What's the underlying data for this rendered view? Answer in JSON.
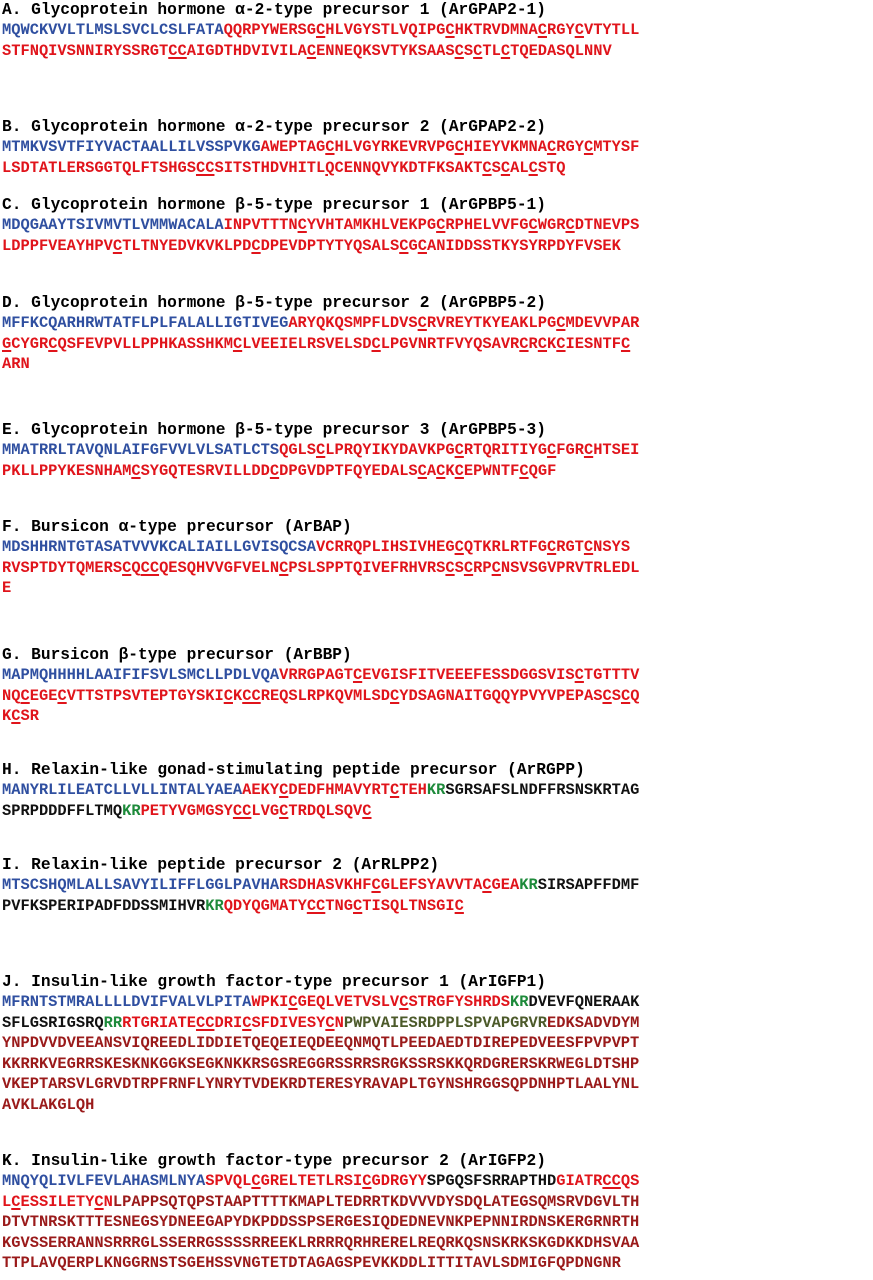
{
  "colors": {
    "sig": "#2f4fa0",
    "pep": "#e0141b",
    "oth": "#111111",
    "kr": "#1d8a3a",
    "ol": "#4c5a2a",
    "dr": "#9a1a1a"
  },
  "sections": [
    {
      "title": "A. Glycoprotein hormone α-2-type precursor 1 (ArGPAP2-1)",
      "lines": [
        [
          [
            "sig",
            "MQWCKVVLTLMSLSVCLCSLFATA"
          ],
          [
            "pep",
            "QQRPYWERSG"
          ],
          [
            "pepu",
            "C"
          ],
          [
            "pep",
            "HLVGYSTLVQIPG"
          ],
          [
            "pepu",
            "C"
          ],
          [
            "pep",
            "HKTRVDMNA"
          ],
          [
            "pepu",
            "C"
          ],
          [
            "pep",
            "RGY"
          ],
          [
            "pepu",
            "C"
          ],
          [
            "pep",
            "VTYTLL"
          ]
        ],
        [
          [
            "pep",
            "STFNQIVSNNIRYSSRGT"
          ],
          [
            "pepu",
            "CC"
          ],
          [
            "pep",
            "AIGDTHDVIVILA"
          ],
          [
            "pepu",
            "C"
          ],
          [
            "pep",
            "ENNEQKSVTYKSAAS"
          ],
          [
            "pepu",
            "C"
          ],
          [
            "pep",
            "S"
          ],
          [
            "pepu",
            "C"
          ],
          [
            "pep",
            "TL"
          ],
          [
            "pepu",
            "C"
          ],
          [
            "pep",
            "TQEDASQLNNV"
          ]
        ]
      ]
    },
    {
      "title": "B. Glycoprotein hormone α-2-type precursor 2 (ArGPAP2-2)",
      "lines": [
        [
          [
            "sig",
            "MTMKVSVTFIYVACTAALLILVSSPVKG"
          ],
          [
            "pep",
            "AWEPTAG"
          ],
          [
            "pepu",
            "C"
          ],
          [
            "pep",
            "HLVGYRKEVRVPG"
          ],
          [
            "pepu",
            "C"
          ],
          [
            "pep",
            "HIEYVKMNA"
          ],
          [
            "pepu",
            "C"
          ],
          [
            "pep",
            "RGY"
          ],
          [
            "pepu",
            "C"
          ],
          [
            "pep",
            "MTYSF"
          ]
        ],
        [
          [
            "pep",
            "LSDTATLERSGGTQLFTSHGS"
          ],
          [
            "pepu",
            "CC"
          ],
          [
            "pep",
            "SITSTHDVHITL"
          ],
          [
            "pepu",
            "Q"
          ],
          [
            "pep",
            "CENNQVYKDTFKSAKT"
          ],
          [
            "pepu",
            "C"
          ],
          [
            "pep",
            "S"
          ],
          [
            "pepu",
            "C"
          ],
          [
            "pep",
            "AL"
          ],
          [
            "pepu",
            "C"
          ],
          [
            "pep",
            "STQ"
          ]
        ]
      ]
    },
    {
      "title": "C. Glycoprotein hormone β-5-type precursor 1 (ArGPBP5-1)",
      "lines": [
        [
          [
            "sig",
            "MDQGAAYTSIVMVTLVMMWACALA"
          ],
          [
            "pep",
            "INPVTTTN"
          ],
          [
            "pepu",
            "C"
          ],
          [
            "pep",
            "YVHTAMKHLVEKPG"
          ],
          [
            "pepu",
            "C"
          ],
          [
            "pep",
            "RPHELVVFG"
          ],
          [
            "pepu",
            "C"
          ],
          [
            "pep",
            "WGR"
          ],
          [
            "pepu",
            "C"
          ],
          [
            "pep",
            "DTNEVPS"
          ]
        ],
        [
          [
            "pep",
            "LDPPFVEAYHPV"
          ],
          [
            "pepu",
            "C"
          ],
          [
            "pep",
            "TLTNYEDVKVKLPD"
          ],
          [
            "pepu",
            "C"
          ],
          [
            "pep",
            "DPEVDPTYTYQSALS"
          ],
          [
            "pepu",
            "C"
          ],
          [
            "pep",
            "G"
          ],
          [
            "pepu",
            "C"
          ],
          [
            "pep",
            "ANIDDSSTKYSYRPDYFVSEK"
          ]
        ]
      ]
    },
    {
      "title": "D. Glycoprotein hormone β-5-type precursor 2 (ArGPBP5-2)",
      "lines": [
        [
          [
            "sig",
            "MFFKCQARHRWTATFLPLFALALLIGTIVEG"
          ],
          [
            "pep",
            "ARYQKQSMPFLDVS"
          ],
          [
            "pepu",
            "C"
          ],
          [
            "pep",
            "RVREYTKYEAKLPG"
          ],
          [
            "pepu",
            "C"
          ],
          [
            "pep",
            "MDEVVPAR"
          ]
        ],
        [
          [
            "pepu",
            "G"
          ],
          [
            "pep",
            "CYGR"
          ],
          [
            "pepu",
            "C"
          ],
          [
            "pep",
            "QSFEVPVLLPPHKASSHKM"
          ],
          [
            "pepu",
            "C"
          ],
          [
            "pep",
            "LVEEIELRSVELSD"
          ],
          [
            "pepu",
            "C"
          ],
          [
            "pep",
            "LPGVNRTFVYQSAVR"
          ],
          [
            "pepu",
            "C"
          ],
          [
            "pep",
            "R"
          ],
          [
            "pepu",
            "C"
          ],
          [
            "pep",
            "K"
          ],
          [
            "pepu",
            "C"
          ],
          [
            "pep",
            "IESNTF"
          ],
          [
            "pepu",
            "C"
          ]
        ],
        [
          [
            "pep",
            "ARN"
          ]
        ]
      ]
    },
    {
      "title": "E. Glycoprotein hormone β-5-type precursor 3 (ArGPBP5-3)",
      "lines": [
        [
          [
            "sig",
            "MMATRRLTAVQNLAIFGFVVLVLSATLCTS"
          ],
          [
            "pep",
            "QGLS"
          ],
          [
            "pepu",
            "C"
          ],
          [
            "pep",
            "LPRQYIKYDAVKPG"
          ],
          [
            "pepu",
            "C"
          ],
          [
            "pep",
            "RTQRITIYG"
          ],
          [
            "pepu",
            "C"
          ],
          [
            "pep",
            "FGR"
          ],
          [
            "pepu",
            "C"
          ],
          [
            "pep",
            "HTSEI"
          ]
        ],
        [
          [
            "pep",
            "PKLLPPYKESNHAM"
          ],
          [
            "pepu",
            "C"
          ],
          [
            "pep",
            "SYGQTESRVILLDD"
          ],
          [
            "pepu",
            "C"
          ],
          [
            "pep",
            "DPGVDPTFQYEDALS"
          ],
          [
            "pepu",
            "C"
          ],
          [
            "pep",
            "A"
          ],
          [
            "pepu",
            "C"
          ],
          [
            "pep",
            "K"
          ],
          [
            "pepu",
            "C"
          ],
          [
            "pep",
            "EPWNTF"
          ],
          [
            "pepu",
            "C"
          ],
          [
            "pep",
            "QGF"
          ]
        ]
      ]
    },
    {
      "title": "F. Bursicon α-type precursor (ArBAP)",
      "lines": [
        [
          [
            "sig",
            "MDSHHRNTGTASATVVVKCALIAILLGVISQCSA"
          ],
          [
            "pep",
            "VCRRQPLIHSIVHEG"
          ],
          [
            "pepu",
            "C"
          ],
          [
            "pep",
            "QTKRLRTFG"
          ],
          [
            "pepu",
            "C"
          ],
          [
            "pep",
            "RGT"
          ],
          [
            "pepu",
            "C"
          ],
          [
            "pep",
            "NSYS"
          ]
        ],
        [
          [
            "pep",
            "RVSPTDYTQMERS"
          ],
          [
            "pepu",
            "C"
          ],
          [
            "pep",
            "Q"
          ],
          [
            "pepu",
            "CC"
          ],
          [
            "pep",
            "QESQHVVGFVELN"
          ],
          [
            "pepu",
            "C"
          ],
          [
            "pep",
            "PSLSPPTQIVEFRHVRS"
          ],
          [
            "pepu",
            "C"
          ],
          [
            "pep",
            "S"
          ],
          [
            "pepu",
            "C"
          ],
          [
            "pep",
            "RP"
          ],
          [
            "pepu",
            "C"
          ],
          [
            "pep",
            "NSVSGVPRVTRLEDL"
          ]
        ],
        [
          [
            "pep",
            "E"
          ]
        ]
      ]
    },
    {
      "title": "G. Bursicon β-type precursor (ArBBP)",
      "lines": [
        [
          [
            "sig",
            "MAPMQHHHHLAAIFIFSVLSMCLLPDLVQA"
          ],
          [
            "pep",
            "VRRGPAGT"
          ],
          [
            "pepu",
            "C"
          ],
          [
            "pep",
            "EVGISFITVEEEFESSDGGSVIS"
          ],
          [
            "pepu",
            "C"
          ],
          [
            "pep",
            "TGTTTV"
          ]
        ],
        [
          [
            "pep",
            "NQ"
          ],
          [
            "pepu",
            "C"
          ],
          [
            "pep",
            "EGE"
          ],
          [
            "pepu",
            "C"
          ],
          [
            "pep",
            "VTTSTPSVTEPTGYSKI"
          ],
          [
            "pepu",
            "C"
          ],
          [
            "pep",
            "K"
          ],
          [
            "pepu",
            "CC"
          ],
          [
            "pep",
            "REQSLRPKQVMLSD"
          ],
          [
            "pepu",
            "C"
          ],
          [
            "pep",
            "YDSAGNAITGQQYPVYVPEPAS"
          ],
          [
            "pepu",
            "C"
          ],
          [
            "pep",
            "S"
          ],
          [
            "pepu",
            "C"
          ],
          [
            "pep",
            "Q"
          ]
        ],
        [
          [
            "pep",
            "K"
          ],
          [
            "pepu",
            "C"
          ],
          [
            "pep",
            "SR"
          ]
        ]
      ]
    },
    {
      "title": "H. Relaxin-like gonad-stimulating peptide precursor (ArRGPP)",
      "lines": [
        [
          [
            "sig",
            "MANYRLILEATCLLVLLINTALYAEA"
          ],
          [
            "pep",
            "AEKY"
          ],
          [
            "pepu",
            "C"
          ],
          [
            "pep",
            "DEDFHMAVYRT"
          ],
          [
            "pepu",
            "C"
          ],
          [
            "pep",
            "TEH"
          ],
          [
            "kr",
            "KR"
          ],
          [
            "oth",
            "SGRSAFSLNDFFRSNSKRTAG"
          ]
        ],
        [
          [
            "oth",
            "SPRPDDDFFLTMQ"
          ],
          [
            "kr",
            "KR"
          ],
          [
            "pep",
            "PETYVGMGSY"
          ],
          [
            "pepu",
            "CC"
          ],
          [
            "pep",
            "LVG"
          ],
          [
            "pepu",
            "C"
          ],
          [
            "pep",
            "TRDQLSQV"
          ],
          [
            "pepu",
            "C"
          ]
        ]
      ]
    },
    {
      "title": "I. Relaxin-like peptide precursor 2 (ArRLPP2)",
      "lines": [
        [
          [
            "sig",
            "MTSCSHQMLALLSAVYILIFFLGGLPAVHA"
          ],
          [
            "pep",
            "RSDHASVKHF"
          ],
          [
            "pepu",
            "C"
          ],
          [
            "pep",
            "GLEFSYAVVTA"
          ],
          [
            "pepu",
            "C"
          ],
          [
            "pep",
            "GEA"
          ],
          [
            "kr",
            "KR"
          ],
          [
            "oth",
            "SIRSAPFFDMF"
          ]
        ],
        [
          [
            "oth",
            "PVFKSPERIPADFDDSSMIHVR"
          ],
          [
            "kr",
            "KR"
          ],
          [
            "pep",
            "QDYQGMATY"
          ],
          [
            "pepu",
            "CC"
          ],
          [
            "pep",
            "TNG"
          ],
          [
            "pepu",
            "C"
          ],
          [
            "pep",
            "TISQLTNSGI"
          ],
          [
            "pepu",
            "C"
          ]
        ]
      ]
    },
    {
      "title": "J. Insulin-like growth factor-type precursor 1 (ArIGFP1)",
      "lines": [
        [
          [
            "sig",
            "MFRNTSTMRALLLLDVIFVALVLPITA"
          ],
          [
            "pep",
            "WPKI"
          ],
          [
            "pepu",
            "C"
          ],
          [
            "pep",
            "GEQLVETVSLV"
          ],
          [
            "pepu",
            "C"
          ],
          [
            "pep",
            "STRGFYSHRDS"
          ],
          [
            "kr",
            "KR"
          ],
          [
            "oth",
            "DVEVFQNERAAK"
          ]
        ],
        [
          [
            "oth",
            "SFLGSRIGSRQ"
          ],
          [
            "kr",
            "RR"
          ],
          [
            "pep",
            "RTGRIATE"
          ],
          [
            "pepu",
            "CC"
          ],
          [
            "pep",
            "DRI"
          ],
          [
            "pepu",
            "C"
          ],
          [
            "pep",
            "SFDIVESY"
          ],
          [
            "pepu",
            "C"
          ],
          [
            "pep",
            "N"
          ],
          [
            "ol",
            "PWPVAIESRDPPLSPVAPGRVR"
          ],
          [
            "dr",
            "EDKSADVDYM"
          ]
        ],
        [
          [
            "dr",
            "YNPDVVDVEEANSVIQREEDLIDDIETQEQEIEQDEEQNMQTLPEEDAEDTDIREPEDVEESFPVPVPT"
          ]
        ],
        [
          [
            "dr",
            "KKRRKVEGRRSKESKNKGGKSEGKNKKRSGSREGGRSSRRSRGKSSRSKKQRDGRERSKRWEGLDTSHP"
          ]
        ],
        [
          [
            "dr",
            "VKEPTARSVLGRVDTRPFRNFLYNRYTVDEKRDTERESYRAVAPLTGYNSHRGGSQPDNHPTLAALYNL"
          ]
        ],
        [
          [
            "dr",
            "AVKLAKGLQH"
          ]
        ]
      ]
    },
    {
      "title": "K. Insulin-like growth factor-type precursor 2 (ArIGFP2)",
      "lines": [
        [
          [
            "sig",
            "MNQYQLIVLFEVLAHASMLNYA"
          ],
          [
            "pep",
            "SPVQL"
          ],
          [
            "pepu",
            "C"
          ],
          [
            "pep",
            "GRELTETLRSI"
          ],
          [
            "pepu",
            "C"
          ],
          [
            "pep",
            "GDRGYY"
          ],
          [
            "oth",
            "SPGQSFSRRAPTHD"
          ],
          [
            "pep",
            "GIATR"
          ],
          [
            "pepu",
            "CC"
          ],
          [
            "pep",
            "QS"
          ]
        ],
        [
          [
            "pep",
            "L"
          ],
          [
            "pepu",
            "C"
          ],
          [
            "pep",
            "ESSILETY"
          ],
          [
            "pepu",
            "C"
          ],
          [
            "pep",
            "N"
          ],
          [
            "dr",
            "LPAPPSQTQPSTAAPTTTTKMAPLTEDRRTKDVVVDYSDQLATEGSQMSRVDGVLTH"
          ]
        ],
        [
          [
            "dr",
            "DTVTNRSKTTTESNEGSYDNEEGAPYDKPDDSSPSERGESIQDEDNEVNKPEPNNIRDNSKERGRNRTH"
          ]
        ],
        [
          [
            "dr",
            "KGVSSERRANNSRRRGLSSERRGSSSSRREEKLRRRRQRHRERELREQRKQSNSKRKSKGDKKDHSVAA"
          ]
        ],
        [
          [
            "dr",
            "TTPLAVQERPLKNGGRNSTSGEHSSVNGTETDTAGAGSPEVKKDDLITTITAVLSDMIGFQPDNGNR"
          ]
        ]
      ]
    }
  ]
}
